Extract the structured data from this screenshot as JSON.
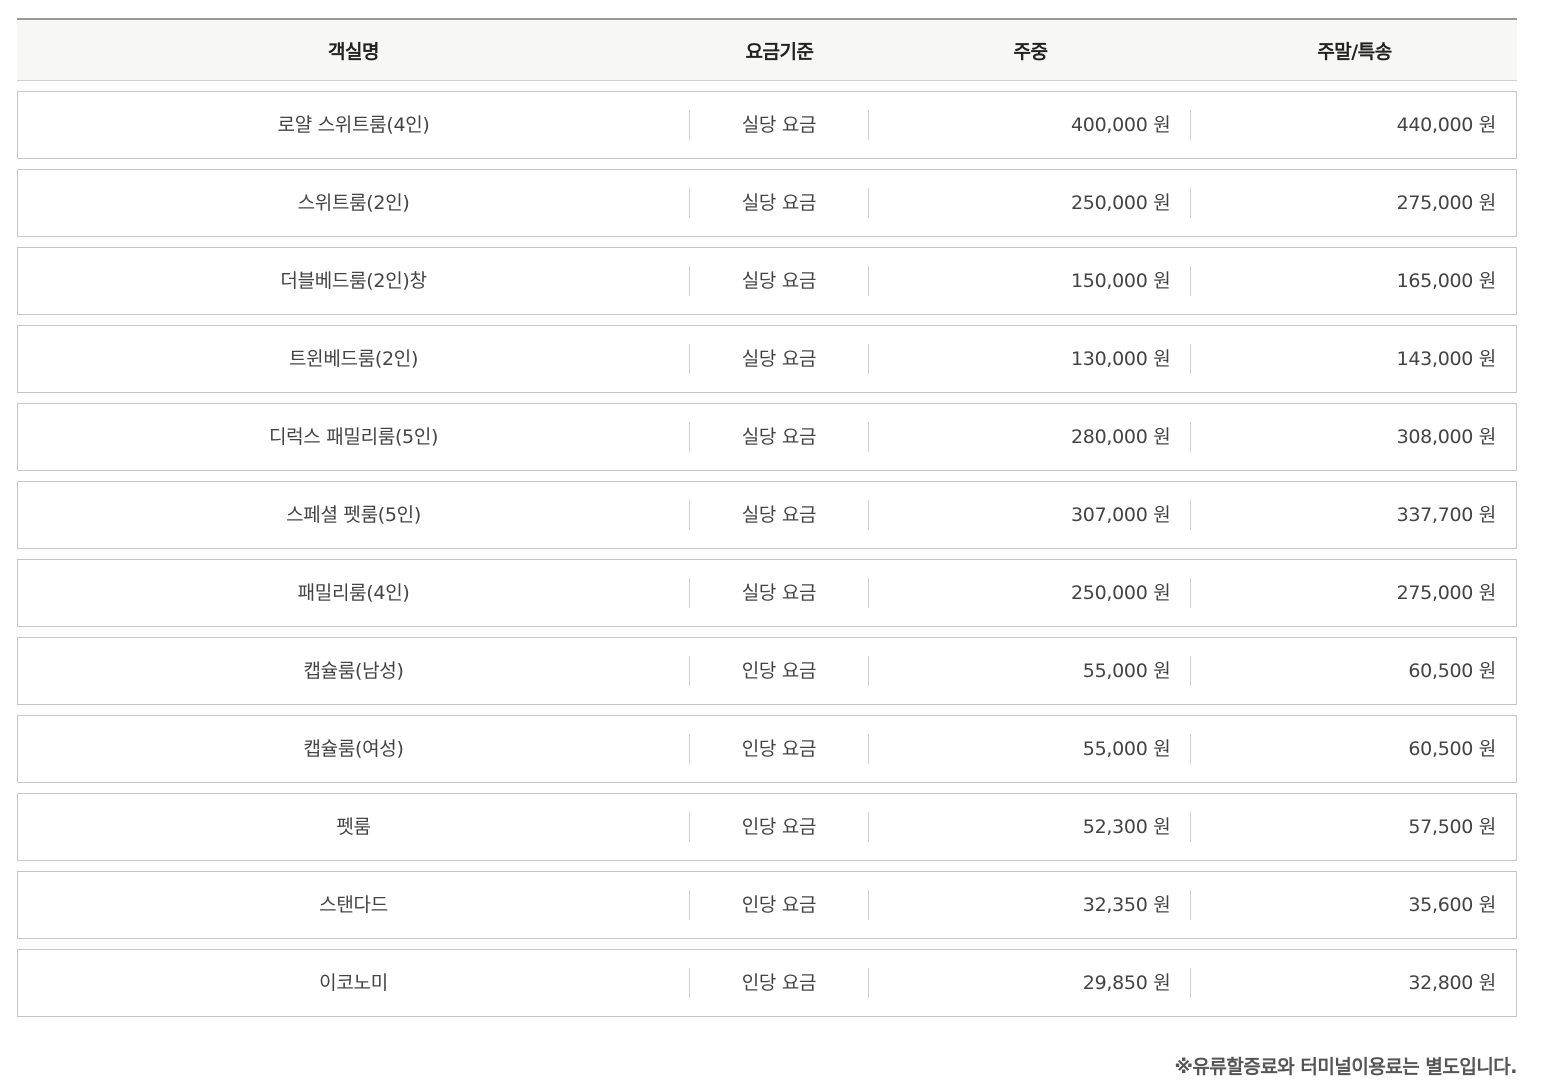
{
  "table": {
    "headers": {
      "room_name": "객실명",
      "rate_basis": "요금기준",
      "weekday": "주중",
      "weekend": "주말/특송"
    },
    "rows": [
      {
        "room_name": "로얄 스위트룸(4인)",
        "rate_basis": "실당 요금",
        "weekday": "400,000 원",
        "weekend": "440,000 원"
      },
      {
        "room_name": "스위트룸(2인)",
        "rate_basis": "실당 요금",
        "weekday": "250,000 원",
        "weekend": "275,000 원"
      },
      {
        "room_name": "더블베드룸(2인)창",
        "rate_basis": "실당 요금",
        "weekday": "150,000 원",
        "weekend": "165,000 원"
      },
      {
        "room_name": "트윈베드룸(2인)",
        "rate_basis": "실당 요금",
        "weekday": "130,000 원",
        "weekend": "143,000 원"
      },
      {
        "room_name": "디럭스 패밀리룸(5인)",
        "rate_basis": "실당 요금",
        "weekday": "280,000 원",
        "weekend": "308,000 원"
      },
      {
        "room_name": "스페셜 펫룸(5인)",
        "rate_basis": "실당 요금",
        "weekday": "307,000 원",
        "weekend": "337,700 원"
      },
      {
        "room_name": "패밀리룸(4인)",
        "rate_basis": "실당 요금",
        "weekday": "250,000 원",
        "weekend": "275,000 원"
      },
      {
        "room_name": "캡슐룸(남성)",
        "rate_basis": "인당 요금",
        "weekday": "55,000 원",
        "weekend": "60,500 원"
      },
      {
        "room_name": "캡슐룸(여성)",
        "rate_basis": "인당 요금",
        "weekday": "55,000 원",
        "weekend": "60,500 원"
      },
      {
        "room_name": "펫룸",
        "rate_basis": "인당 요금",
        "weekday": "52,300 원",
        "weekend": "57,500 원"
      },
      {
        "room_name": "스탠다드",
        "rate_basis": "인당 요금",
        "weekday": "32,350 원",
        "weekend": "35,600 원"
      },
      {
        "room_name": "이코노미",
        "rate_basis": "인당 요금",
        "weekday": "29,850 원",
        "weekend": "32,800 원"
      }
    ]
  },
  "note": "※유류할증료와 터미널이용료는 별도입니다."
}
